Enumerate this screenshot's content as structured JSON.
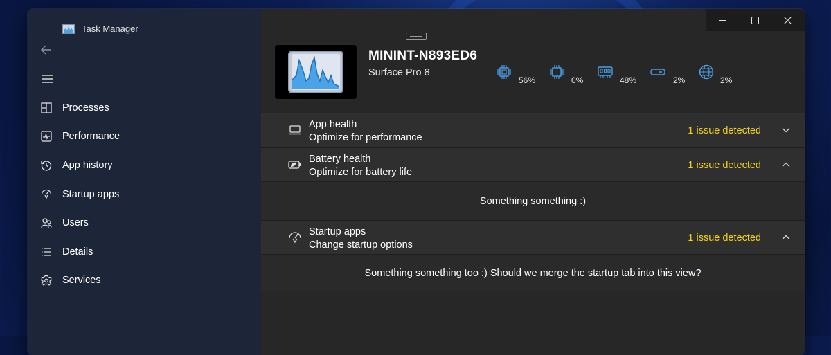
{
  "window": {
    "title": "Task Manager"
  },
  "sidebar": {
    "items": [
      {
        "label": "Processes",
        "icon": "processes-icon"
      },
      {
        "label": "Performance",
        "icon": "performance-icon"
      },
      {
        "label": "App history",
        "icon": "app-history-icon"
      },
      {
        "label": "Startup apps",
        "icon": "startup-apps-icon"
      },
      {
        "label": "Users",
        "icon": "users-icon"
      },
      {
        "label": "Details",
        "icon": "details-icon"
      },
      {
        "label": "Services",
        "icon": "services-icon"
      }
    ]
  },
  "device": {
    "name": "MININT-N893ED6",
    "model": "Surface Pro 8"
  },
  "metrics": [
    {
      "name": "cpu",
      "icon": "cpu-icon",
      "value": "56%"
    },
    {
      "name": "gpu",
      "icon": "gpu-icon",
      "value": "0%"
    },
    {
      "name": "memory",
      "icon": "memory-icon",
      "value": "48%"
    },
    {
      "name": "disk",
      "icon": "disk-icon",
      "value": "2%"
    },
    {
      "name": "network",
      "icon": "network-icon",
      "value": "2%"
    }
  ],
  "sections": [
    {
      "title": "App health",
      "subtitle": "Optimize for performance",
      "status": "1 issue detected",
      "expanded": false,
      "icon": "laptop-icon"
    },
    {
      "title": "Battery health",
      "subtitle": "Optimize for battery life",
      "status": "1 issue detected",
      "expanded": true,
      "icon": "battery-leaf-icon",
      "body": "Something something :)"
    },
    {
      "title": "Startup apps",
      "subtitle": "Change startup options",
      "status": "1 issue detected",
      "expanded": true,
      "icon": "startup-gauge-icon",
      "body": "Something something too :) Should we merge the startup tab into this view?"
    }
  ],
  "colors": {
    "accent": "#4a9fe6",
    "warning": "#f2d21b",
    "sidebar_bg": "#1d2638",
    "main_bg": "#272727"
  }
}
